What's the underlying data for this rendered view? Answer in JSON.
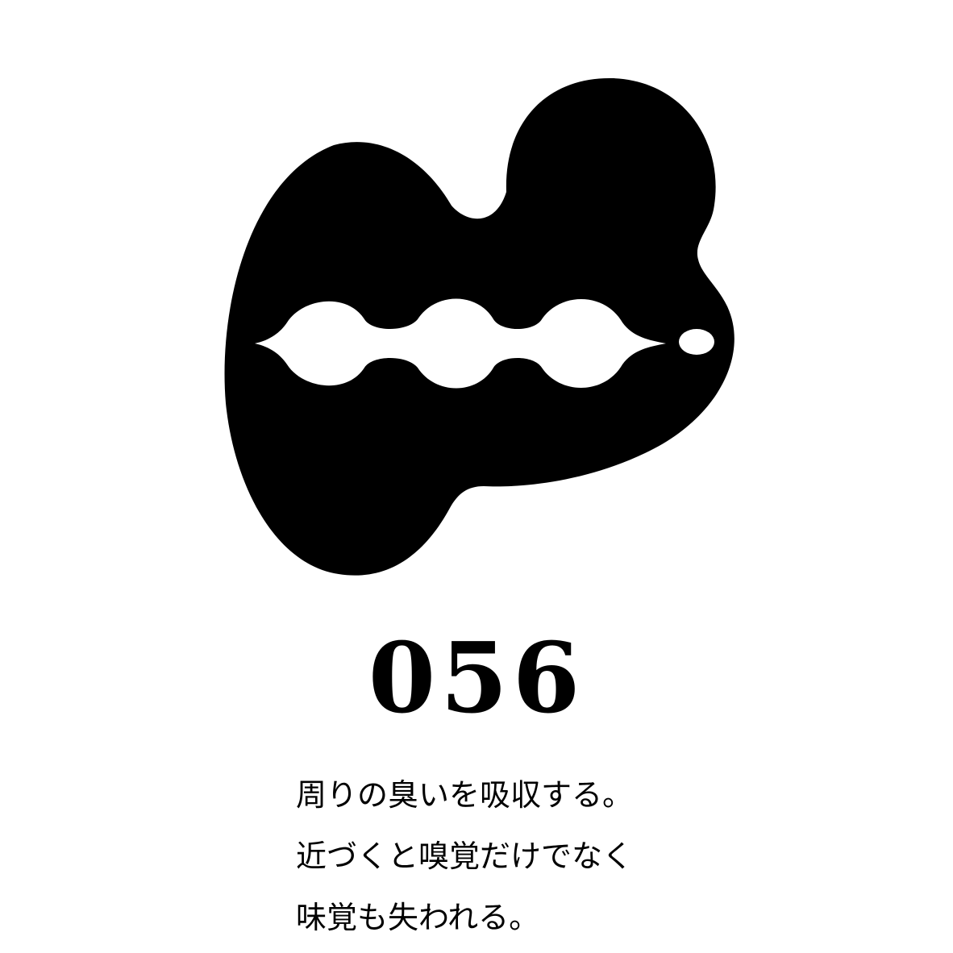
{
  "card": {
    "number": "056",
    "description_lines": [
      "周りの臭いを吸収する。",
      "近づくと嗅覚だけでなく",
      "味覚も失われる。"
    ]
  },
  "colors": {
    "background": "#ffffff",
    "ink": "#000000"
  },
  "illustration": {
    "icon": "smell-absorbing-creature-icon"
  }
}
